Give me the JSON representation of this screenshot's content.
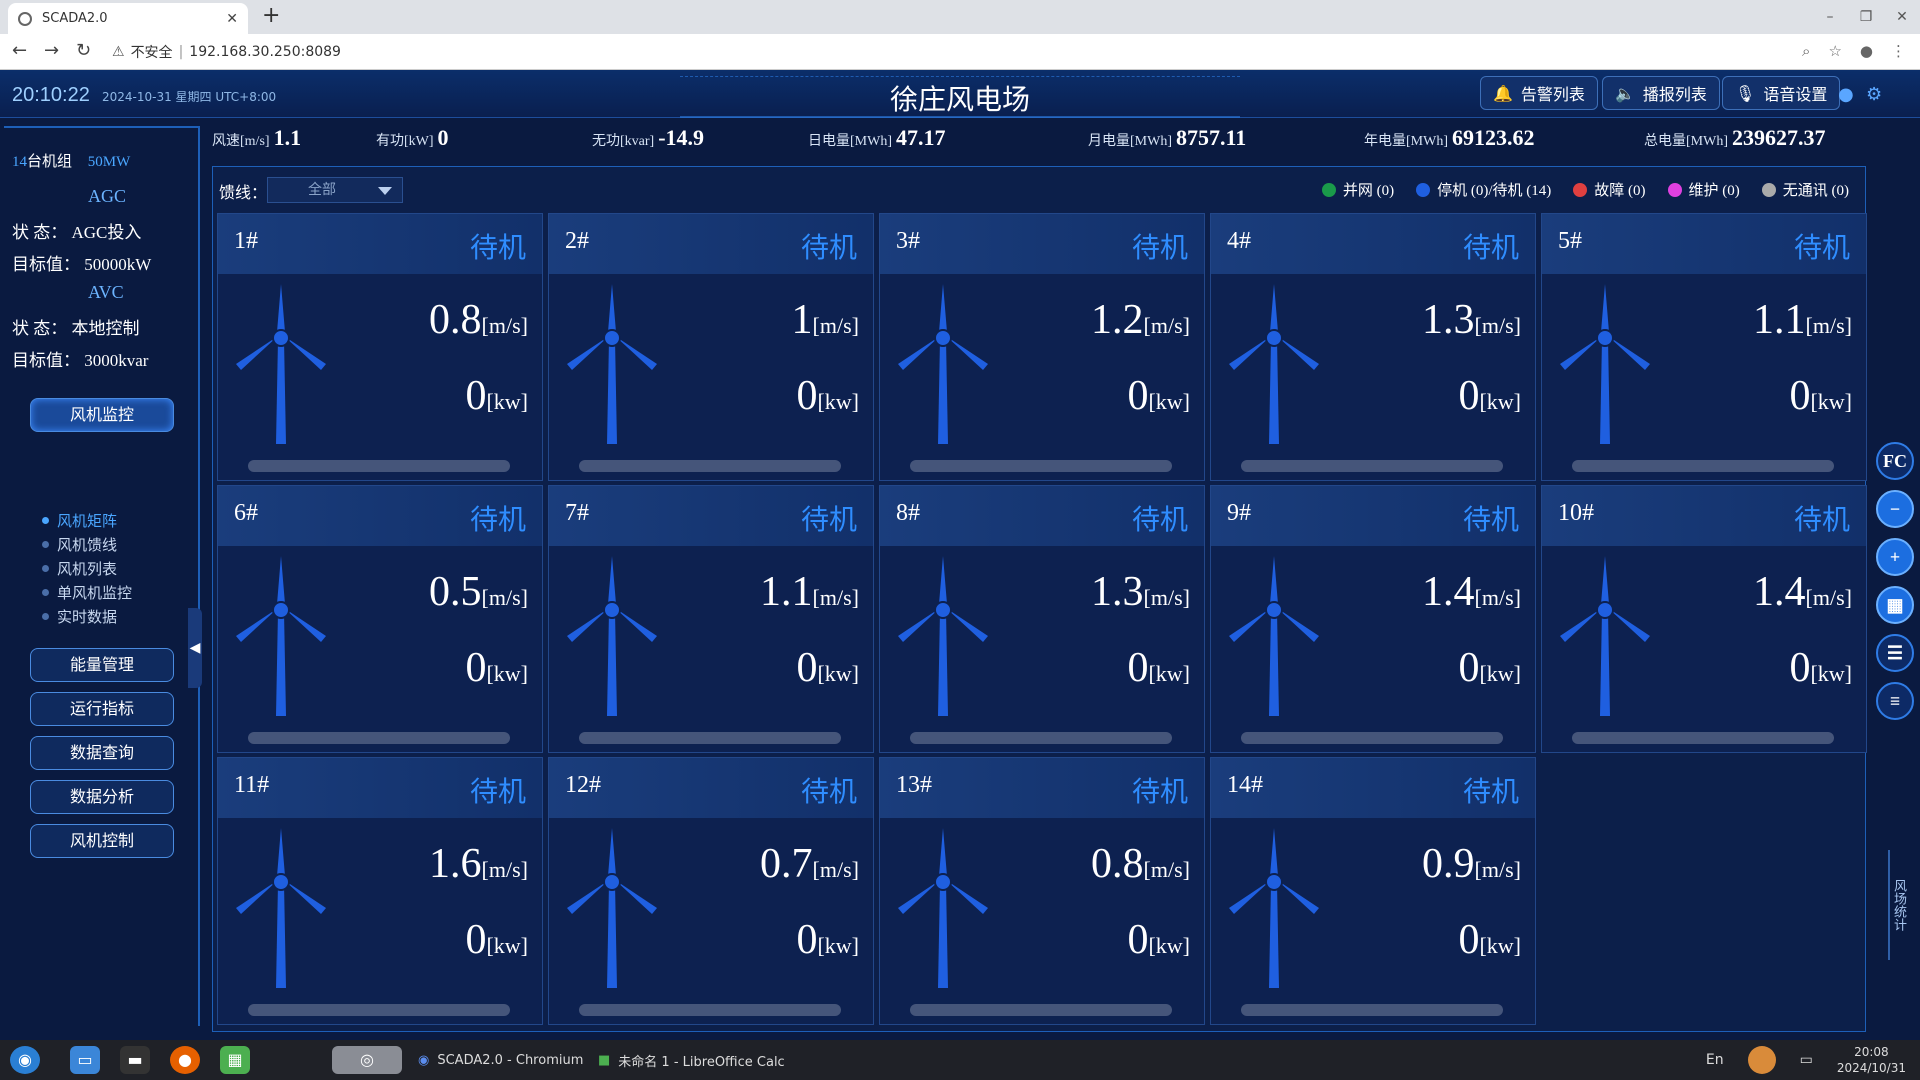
{
  "browser": {
    "tab_title": "SCADA2.0",
    "new_tab": "+",
    "security": "不安全",
    "url": "192.168.30.250:8089"
  },
  "header": {
    "time": "20:10:22",
    "date": "2024-10-31 星期四 UTC+8:00",
    "title": "徐庄风电场",
    "buttons": [
      "告警列表",
      "播报列表",
      "语音设置"
    ]
  },
  "sidebar": {
    "count": "14",
    "count_suffix": "台机组",
    "capacity": "50MW",
    "agc_title": "AGC",
    "agc_state_label": "状 态：",
    "agc_state": "AGC投入",
    "agc_target_label": "目标值：",
    "agc_target": "50000kW",
    "avc_title": "AVC",
    "avc_state_label": "状 态：",
    "avc_state": "本地控制",
    "avc_target_label": "目标值：",
    "avc_target": "3000kvar",
    "menu": [
      "风机监控",
      "能量管理",
      "运行指标",
      "数据查询",
      "数据分析",
      "风机控制"
    ],
    "submenu": [
      "风机矩阵",
      "风机馈线",
      "风机列表",
      "单风机监控",
      "实时数据"
    ]
  },
  "stats": [
    {
      "label": "风速[m/s]",
      "value": "1.1"
    },
    {
      "label": "有功[kW]",
      "value": "0"
    },
    {
      "label": "无功[kvar]",
      "value": "-14.9"
    },
    {
      "label": "日电量[MWh]",
      "value": "47.17"
    },
    {
      "label": "月电量[MWh]",
      "value": "8757.11"
    },
    {
      "label": "年电量[MWh]",
      "value": "69123.62"
    },
    {
      "label": "总电量[MWh]",
      "value": "239627.37"
    }
  ],
  "feeder": {
    "label": "馈线：",
    "value": "全部"
  },
  "legend": [
    {
      "label": "并网 (0)",
      "color": "#1a9a4a"
    },
    {
      "label": "停机 (0)/待机 (14)",
      "color": "#1f5fe0"
    },
    {
      "label": "故障 (0)",
      "color": "#e04040"
    },
    {
      "label": "维护 (0)",
      "color": "#e040e0"
    },
    {
      "label": "无通讯 (0)",
      "color": "#aaaaaa"
    }
  ],
  "turbines": [
    {
      "id": "1#",
      "status": "待机",
      "wind": "0.8",
      "power": "0"
    },
    {
      "id": "2#",
      "status": "待机",
      "wind": "1",
      "power": "0"
    },
    {
      "id": "3#",
      "status": "待机",
      "wind": "1.2",
      "power": "0"
    },
    {
      "id": "4#",
      "status": "待机",
      "wind": "1.3",
      "power": "0"
    },
    {
      "id": "5#",
      "status": "待机",
      "wind": "1.1",
      "power": "0"
    },
    {
      "id": "6#",
      "status": "待机",
      "wind": "0.5",
      "power": "0"
    },
    {
      "id": "7#",
      "status": "待机",
      "wind": "1.1",
      "power": "0"
    },
    {
      "id": "8#",
      "status": "待机",
      "wind": "1.3",
      "power": "0"
    },
    {
      "id": "9#",
      "status": "待机",
      "wind": "1.4",
      "power": "0"
    },
    {
      "id": "10#",
      "status": "待机",
      "wind": "1.4",
      "power": "0"
    },
    {
      "id": "11#",
      "status": "待机",
      "wind": "1.6",
      "power": "0"
    },
    {
      "id": "12#",
      "status": "待机",
      "wind": "0.7",
      "power": "0"
    },
    {
      "id": "13#",
      "status": "待机",
      "wind": "0.8",
      "power": "0"
    },
    {
      "id": "14#",
      "status": "待机",
      "wind": "0.9",
      "power": "0"
    }
  ],
  "units": {
    "wind": "[m/s]",
    "power": "[kw]"
  },
  "right_tools": {
    "fc": "FC",
    "side_tab": "风场统计"
  },
  "taskbar": {
    "apps": [
      "SCADA2.0 - Chromium",
      "未命名 1 - LibreOffice Calc"
    ],
    "lang": "En",
    "time": "20:08",
    "date": "2024/10/31"
  }
}
